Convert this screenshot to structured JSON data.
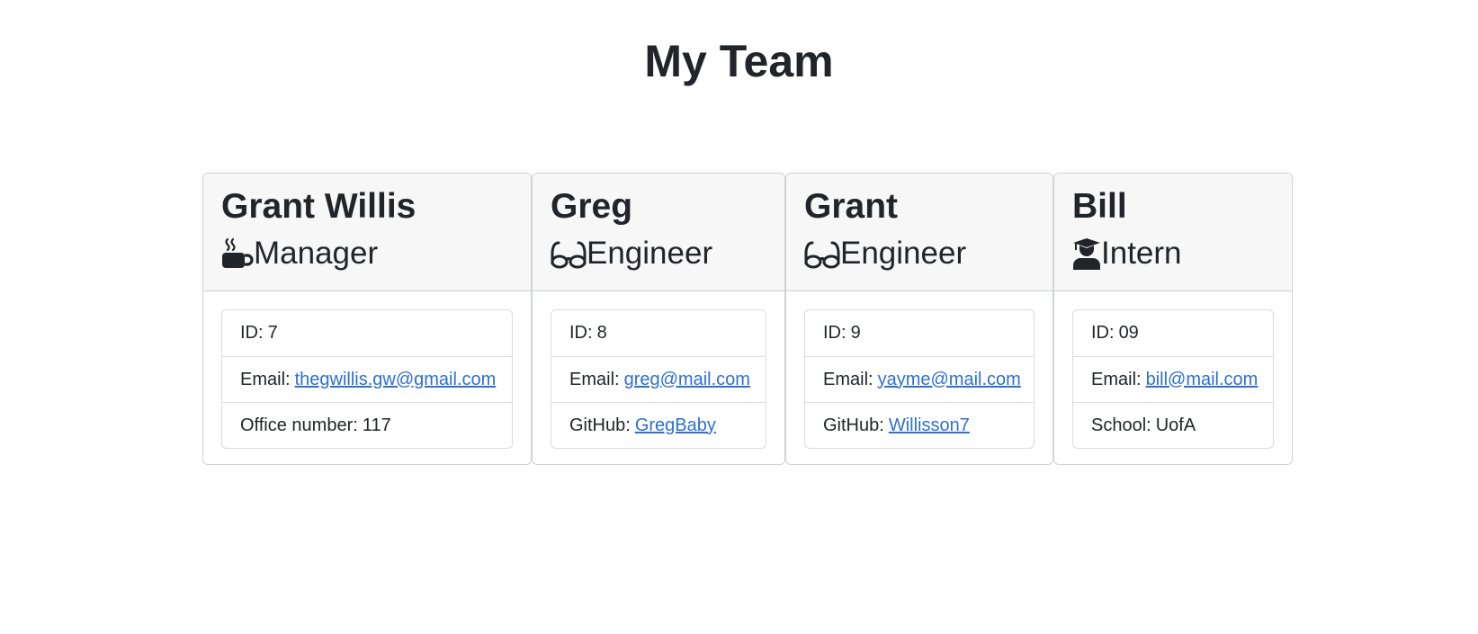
{
  "page": {
    "title": "My Team"
  },
  "team": [
    {
      "name": "Grant Willis",
      "role": "Manager",
      "icon": "mug-hot-icon",
      "id_label": "ID:",
      "id": "7",
      "email_label": "Email:",
      "email": "thegwillis.gw@gmail.com",
      "extra_label": "Office number:",
      "extra_value": "117"
    },
    {
      "name": "Greg",
      "role": "Engineer",
      "icon": "glasses-icon",
      "id_label": "ID:",
      "id": "8",
      "email_label": "Email:",
      "email": "greg@mail.com",
      "extra_label": "GitHub:",
      "extra_value": "GregBaby"
    },
    {
      "name": "Grant",
      "role": "Engineer",
      "icon": "glasses-icon",
      "id_label": "ID:",
      "id": "9",
      "email_label": "Email:",
      "email": "yayme@mail.com",
      "extra_label": "GitHub:",
      "extra_value": "Willisson7"
    },
    {
      "name": "Bill",
      "role": "Intern",
      "icon": "graduate-icon",
      "id_label": "ID:",
      "id": "09",
      "email_label": "Email:",
      "email": "bill@mail.com",
      "extra_label": "School:",
      "extra_value": "UofA"
    }
  ],
  "colors": {
    "text": "#212529",
    "link": "#2f6fcf",
    "header_bg": "#f7f7f7",
    "border": "#cfd2d6"
  }
}
